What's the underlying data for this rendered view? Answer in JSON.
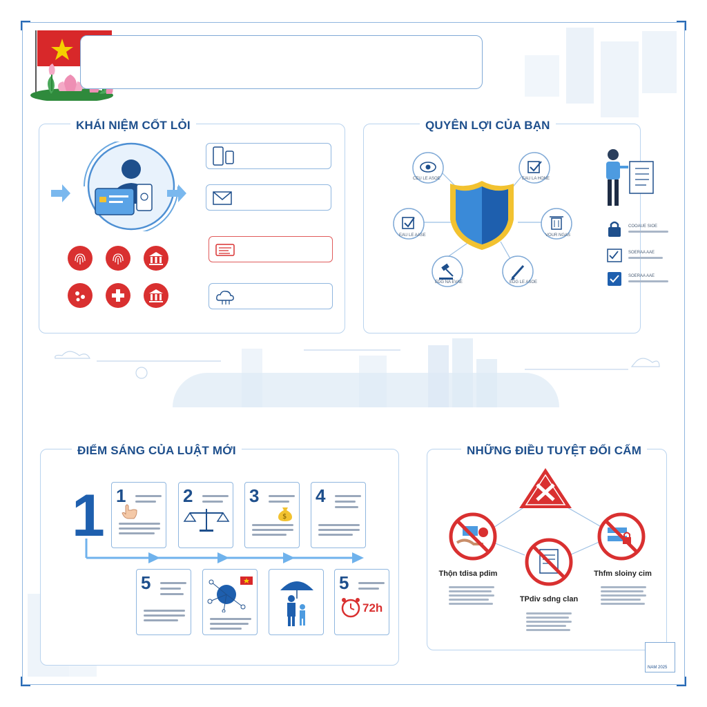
{
  "title_box": {
    "text": ""
  },
  "sections": {
    "core_concepts": {
      "title": "KHÁI NIỆM CỐT LỎI"
    },
    "your_rights": {
      "title": "QUYÊN LỢI CỦA BẠN",
      "nodes": [
        "CEU LE ASOE",
        "EAU LA HONE",
        "EAU LE AASE",
        "VOUR NGAS",
        "EDG NA EVAE",
        "EDG LE ASOE"
      ],
      "side_items": [
        "COOAUE SIOE",
        "SOERAA AAE",
        "SOERAA AAE"
      ]
    },
    "new_law_highlights": {
      "title": "ĐIỂM SÁNG CỦA LUẬT MỚI",
      "big_number": "1",
      "steps_top": [
        "1",
        "2",
        "3",
        "4"
      ],
      "steps_bottom_numbers": [
        "5",
        "5"
      ],
      "time_label": "72h"
    },
    "prohibited": {
      "title": "NHỮNG ĐIỀU TUYỆT ĐỔI CẤM",
      "items": [
        {
          "caption": "Thộn tdisa pdim"
        },
        {
          "caption": "TPdiv sdng clan"
        },
        {
          "caption": "Thfm sloiny cim"
        }
      ]
    }
  },
  "footer": {
    "stamp": "NAM 2025"
  },
  "colors": {
    "primary": "#1e4f8c",
    "accent_red": "#d93030",
    "light_blue": "#8fb6df",
    "shield_gold": "#f2c230",
    "shield_blue": "#3a8ad8"
  }
}
